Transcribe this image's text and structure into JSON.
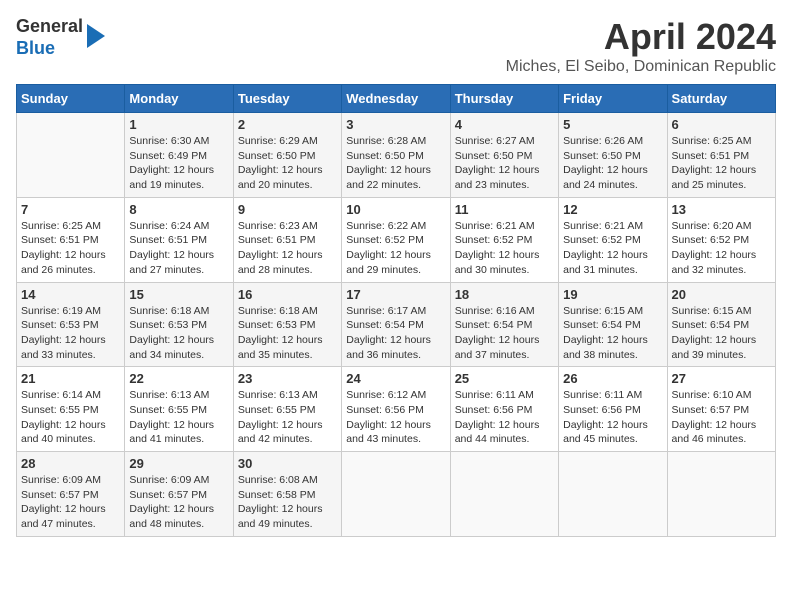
{
  "header": {
    "logo_line1": "General",
    "logo_line2": "Blue",
    "title": "April 2024",
    "subtitle": "Miches, El Seibo, Dominican Republic"
  },
  "calendar": {
    "weekdays": [
      "Sunday",
      "Monday",
      "Tuesday",
      "Wednesday",
      "Thursday",
      "Friday",
      "Saturday"
    ],
    "weeks": [
      [
        {
          "day": "",
          "info": ""
        },
        {
          "day": "1",
          "info": "Sunrise: 6:30 AM\nSunset: 6:49 PM\nDaylight: 12 hours\nand 19 minutes."
        },
        {
          "day": "2",
          "info": "Sunrise: 6:29 AM\nSunset: 6:50 PM\nDaylight: 12 hours\nand 20 minutes."
        },
        {
          "day": "3",
          "info": "Sunrise: 6:28 AM\nSunset: 6:50 PM\nDaylight: 12 hours\nand 22 minutes."
        },
        {
          "day": "4",
          "info": "Sunrise: 6:27 AM\nSunset: 6:50 PM\nDaylight: 12 hours\nand 23 minutes."
        },
        {
          "day": "5",
          "info": "Sunrise: 6:26 AM\nSunset: 6:50 PM\nDaylight: 12 hours\nand 24 minutes."
        },
        {
          "day": "6",
          "info": "Sunrise: 6:25 AM\nSunset: 6:51 PM\nDaylight: 12 hours\nand 25 minutes."
        }
      ],
      [
        {
          "day": "7",
          "info": "Sunrise: 6:25 AM\nSunset: 6:51 PM\nDaylight: 12 hours\nand 26 minutes."
        },
        {
          "day": "8",
          "info": "Sunrise: 6:24 AM\nSunset: 6:51 PM\nDaylight: 12 hours\nand 27 minutes."
        },
        {
          "day": "9",
          "info": "Sunrise: 6:23 AM\nSunset: 6:51 PM\nDaylight: 12 hours\nand 28 minutes."
        },
        {
          "day": "10",
          "info": "Sunrise: 6:22 AM\nSunset: 6:52 PM\nDaylight: 12 hours\nand 29 minutes."
        },
        {
          "day": "11",
          "info": "Sunrise: 6:21 AM\nSunset: 6:52 PM\nDaylight: 12 hours\nand 30 minutes."
        },
        {
          "day": "12",
          "info": "Sunrise: 6:21 AM\nSunset: 6:52 PM\nDaylight: 12 hours\nand 31 minutes."
        },
        {
          "day": "13",
          "info": "Sunrise: 6:20 AM\nSunset: 6:52 PM\nDaylight: 12 hours\nand 32 minutes."
        }
      ],
      [
        {
          "day": "14",
          "info": "Sunrise: 6:19 AM\nSunset: 6:53 PM\nDaylight: 12 hours\nand 33 minutes."
        },
        {
          "day": "15",
          "info": "Sunrise: 6:18 AM\nSunset: 6:53 PM\nDaylight: 12 hours\nand 34 minutes."
        },
        {
          "day": "16",
          "info": "Sunrise: 6:18 AM\nSunset: 6:53 PM\nDaylight: 12 hours\nand 35 minutes."
        },
        {
          "day": "17",
          "info": "Sunrise: 6:17 AM\nSunset: 6:54 PM\nDaylight: 12 hours\nand 36 minutes."
        },
        {
          "day": "18",
          "info": "Sunrise: 6:16 AM\nSunset: 6:54 PM\nDaylight: 12 hours\nand 37 minutes."
        },
        {
          "day": "19",
          "info": "Sunrise: 6:15 AM\nSunset: 6:54 PM\nDaylight: 12 hours\nand 38 minutes."
        },
        {
          "day": "20",
          "info": "Sunrise: 6:15 AM\nSunset: 6:54 PM\nDaylight: 12 hours\nand 39 minutes."
        }
      ],
      [
        {
          "day": "21",
          "info": "Sunrise: 6:14 AM\nSunset: 6:55 PM\nDaylight: 12 hours\nand 40 minutes."
        },
        {
          "day": "22",
          "info": "Sunrise: 6:13 AM\nSunset: 6:55 PM\nDaylight: 12 hours\nand 41 minutes."
        },
        {
          "day": "23",
          "info": "Sunrise: 6:13 AM\nSunset: 6:55 PM\nDaylight: 12 hours\nand 42 minutes."
        },
        {
          "day": "24",
          "info": "Sunrise: 6:12 AM\nSunset: 6:56 PM\nDaylight: 12 hours\nand 43 minutes."
        },
        {
          "day": "25",
          "info": "Sunrise: 6:11 AM\nSunset: 6:56 PM\nDaylight: 12 hours\nand 44 minutes."
        },
        {
          "day": "26",
          "info": "Sunrise: 6:11 AM\nSunset: 6:56 PM\nDaylight: 12 hours\nand 45 minutes."
        },
        {
          "day": "27",
          "info": "Sunrise: 6:10 AM\nSunset: 6:57 PM\nDaylight: 12 hours\nand 46 minutes."
        }
      ],
      [
        {
          "day": "28",
          "info": "Sunrise: 6:09 AM\nSunset: 6:57 PM\nDaylight: 12 hours\nand 47 minutes."
        },
        {
          "day": "29",
          "info": "Sunrise: 6:09 AM\nSunset: 6:57 PM\nDaylight: 12 hours\nand 48 minutes."
        },
        {
          "day": "30",
          "info": "Sunrise: 6:08 AM\nSunset: 6:58 PM\nDaylight: 12 hours\nand 49 minutes."
        },
        {
          "day": "",
          "info": ""
        },
        {
          "day": "",
          "info": ""
        },
        {
          "day": "",
          "info": ""
        },
        {
          "day": "",
          "info": ""
        }
      ]
    ]
  }
}
